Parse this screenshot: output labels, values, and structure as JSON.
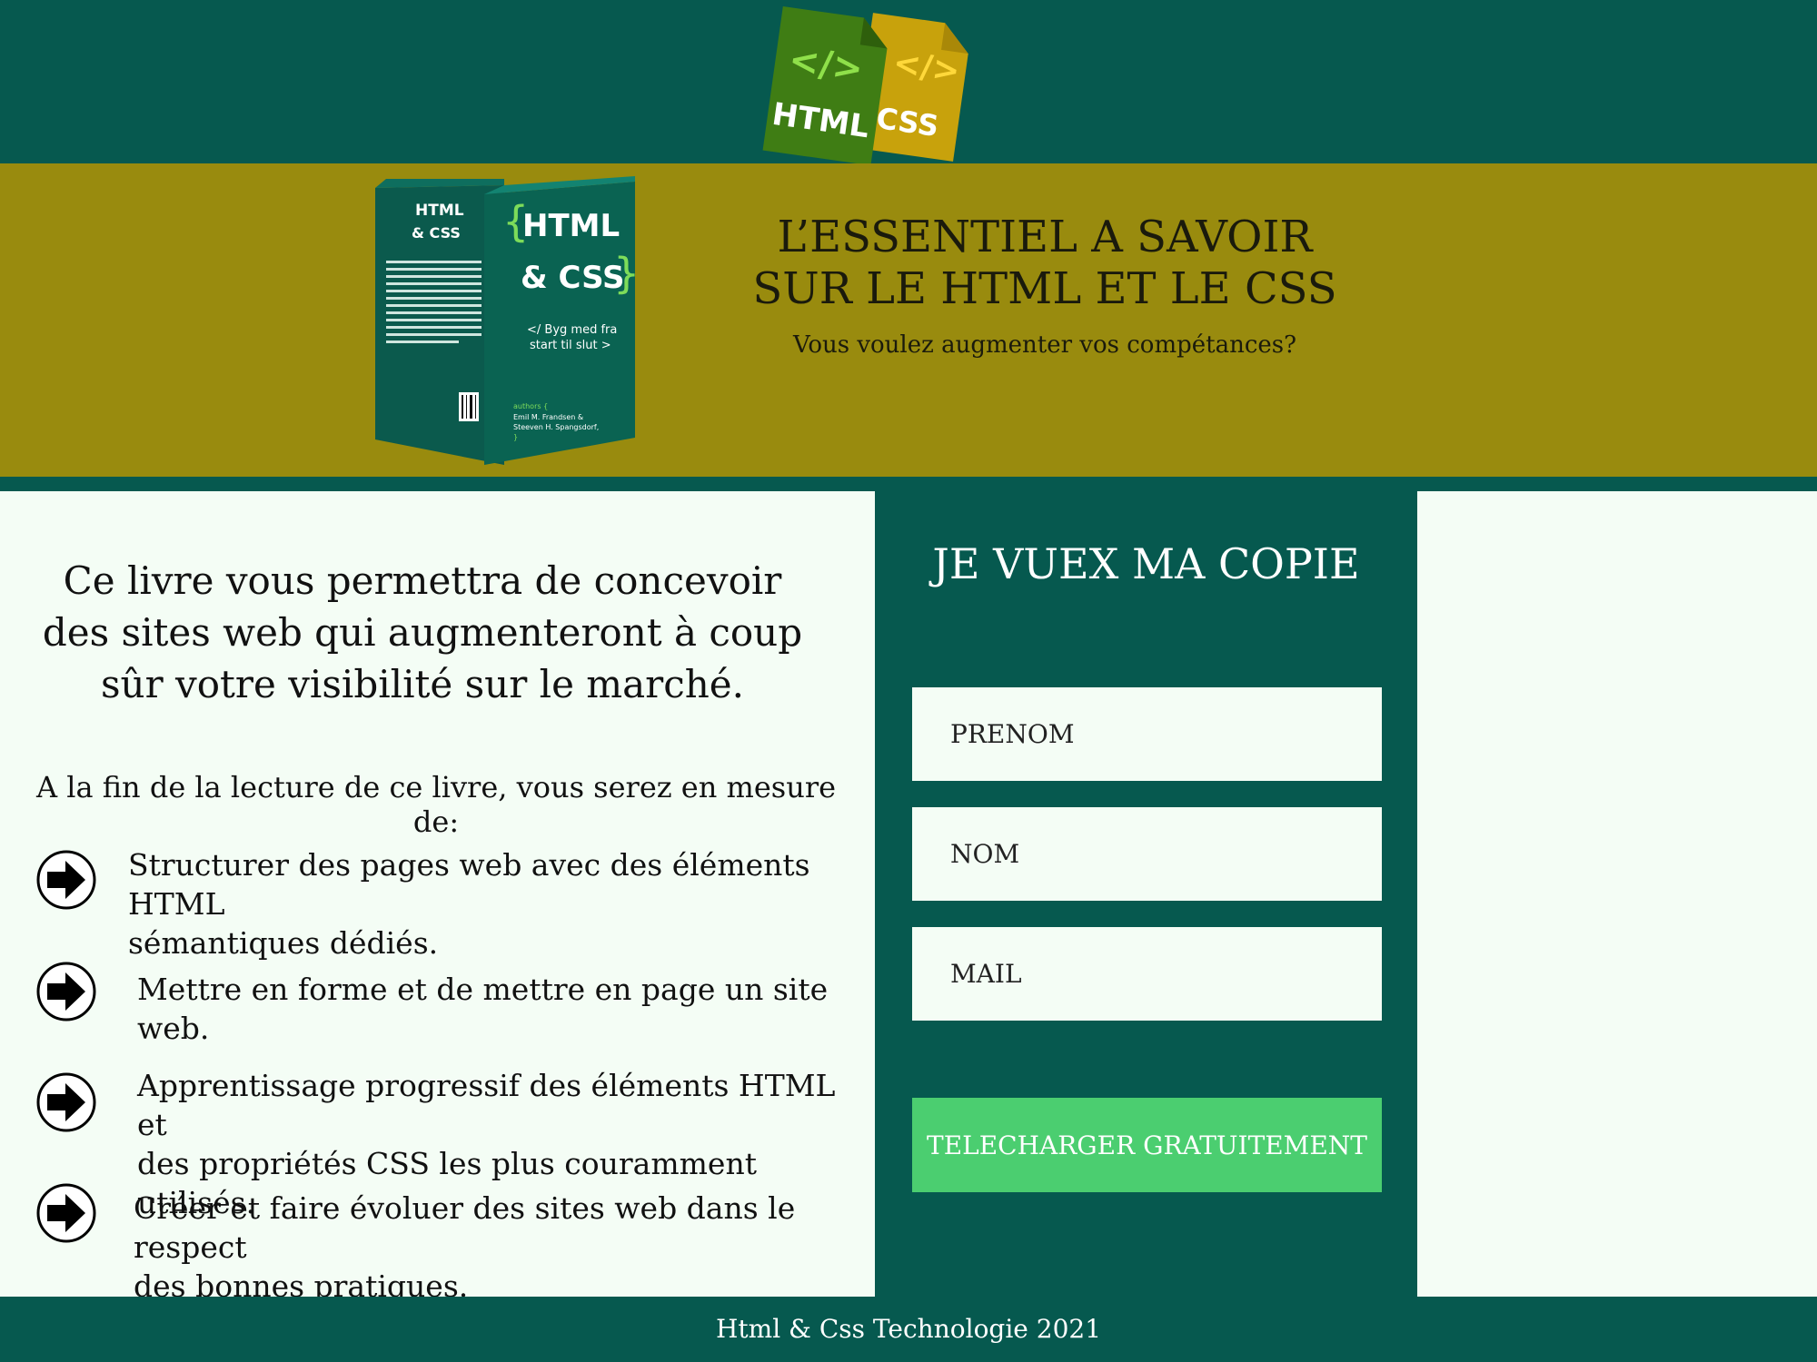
{
  "header": {
    "logo": {
      "html_label": "HTML",
      "css_label": "CSS",
      "code_glyph": "</>"
    }
  },
  "hero": {
    "title_line1": "L’ESSENTIEL A SAVOIR",
    "title_line2": "SUR LE HTML ET LE CSS",
    "subtitle": "Vous voulez augmenter vos compétances?",
    "book": {
      "spine_html": "HTML",
      "spine_amp_css": "& CSS",
      "front_html": "HTML",
      "front_css": "& CSS",
      "tagline1": "</ Byg med fra",
      "tagline2": "start til slut >",
      "authors_label": "authors {",
      "authors1": "Emil M. Frandsen &",
      "authors2": "Steeven H. Spangsdorf,",
      "authors_close": "}"
    }
  },
  "content": {
    "intro_line1": "Ce livre vous permettra de concevoir",
    "intro_line2": "des sites web qui augmenteront à coup",
    "intro_line3": "sûr votre visibilité sur le marché.",
    "lead": "A la fin de la lecture de ce livre, vous serez en mesure de:",
    "benefits": [
      {
        "line1": "Structurer des pages web avec des éléments HTML",
        "line2": "sémantiques dédiés."
      },
      {
        "line1": "Mettre en forme et de mettre en page un site web.",
        "line2": ""
      },
      {
        "line1": "Apprentissage progressif des éléments HTML et",
        "line2": "des propriétés CSS les plus couramment utilisés."
      },
      {
        "line1": "Créer et faire évoluer des sites web dans le respect",
        "line2": "des bonnes pratiques."
      }
    ]
  },
  "form": {
    "title": "JE VUEX MA COPIE",
    "first_name_placeholder": "PRENOM",
    "last_name_placeholder": "NOM",
    "email_placeholder": "MAIL",
    "submit_label": "TELECHARGER GRATUITEMENT"
  },
  "footer": {
    "text": "Html & Css Technologie 2021"
  },
  "colors": {
    "dark_green": "#06594f",
    "olive": "#998b0e",
    "light_bg": "#f4fdf5",
    "button_green": "#4bce70",
    "logo_html_green": "#3f7d14",
    "logo_css_gold": "#c8a20c"
  },
  "icons": {
    "benefit_bullet": "arrow-right-circle-icon",
    "logo": "html-css-file-icon"
  }
}
